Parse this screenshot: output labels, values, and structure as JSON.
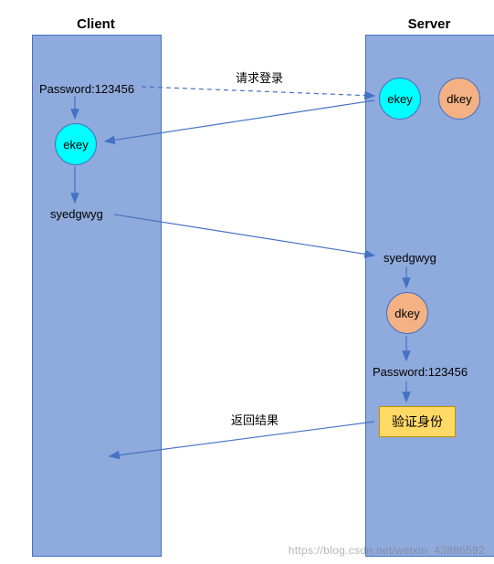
{
  "headers": {
    "client": "Client",
    "server": "Server"
  },
  "client": {
    "password_label": "Password:123456",
    "ekey": "ekey",
    "encrypted": "syedgwyg"
  },
  "server": {
    "ekey": "ekey",
    "dkey_top": "dkey",
    "encrypted": "syedgwyg",
    "dkey_mid": "dkey",
    "password_label": "Password:123456",
    "verify_box": "验证身份"
  },
  "arrows": {
    "request_login": "请求登录",
    "return_result": "返回结果"
  },
  "watermark": "https://blog.csdn.net/weixin_43886592",
  "chart_data": {
    "type": "sequence-diagram",
    "actors": [
      "Client",
      "Server"
    ],
    "steps": [
      {
        "from": "Client",
        "to": "Server",
        "label": "请求登录",
        "style": "dashed",
        "note": "Client has Password:123456"
      },
      {
        "at": "Server",
        "state": "has ekey and dkey"
      },
      {
        "from": "Server",
        "to": "Client",
        "label": "",
        "payload": "ekey"
      },
      {
        "at": "Client",
        "action": "encrypt with ekey",
        "input": "Password:123456",
        "output": "syedgwyg"
      },
      {
        "from": "Client",
        "to": "Server",
        "label": "",
        "payload": "syedgwyg"
      },
      {
        "at": "Server",
        "action": "decrypt with dkey",
        "input": "syedgwyg",
        "output": "Password:123456"
      },
      {
        "at": "Server",
        "action": "验证身份"
      },
      {
        "from": "Server",
        "to": "Client",
        "label": "返回结果"
      }
    ]
  }
}
